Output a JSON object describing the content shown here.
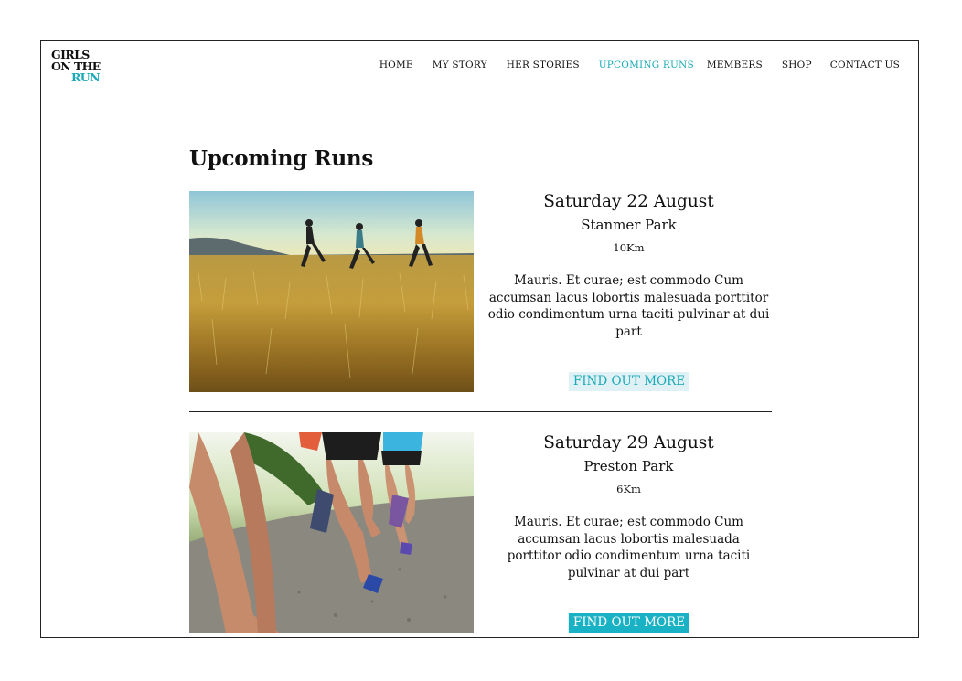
{
  "brand": {
    "line1": "GIRLS",
    "line2": "ON THE",
    "line3": "RUN",
    "accent": "#1aa9b8"
  },
  "nav": {
    "items": [
      {
        "label": "HOME",
        "active": false
      },
      {
        "label": "MY STORY",
        "active": false
      },
      {
        "label": "HER STORIES",
        "active": false
      },
      {
        "label": "UPCOMING RUNS",
        "active": true
      },
      {
        "label": "MEMBERS",
        "active": false
      },
      {
        "label": "SHOP",
        "active": false
      },
      {
        "label": "CONTACT US",
        "active": false
      }
    ]
  },
  "page": {
    "title": "Upcoming Runs"
  },
  "runs": [
    {
      "date": "Saturday 22 August",
      "location": "Stanmer Park",
      "distance": "10Km",
      "description": "Mauris. Et curae; est commodo Cum accumsan lacus lobortis malesuada porttitor odio condimentum urna taciti pulvinar at dui part",
      "button": "FIND OUT MORE",
      "button_style": "light"
    },
    {
      "date": "Saturday 29 August",
      "location": "Preston Park",
      "distance": "6Km",
      "description": "Mauris. Et curae; est commodo Cum accumsan lacus lobortis malesuada porttitor odio condimentum urna taciti pulvinar at dui part",
      "button": "FIND OUT MORE",
      "button_style": "solid"
    }
  ],
  "colors": {
    "accent": "#1aa9b8",
    "button_light_bg": "#dff1f4",
    "button_solid_bg": "#19b1c4",
    "text": "#111111"
  }
}
